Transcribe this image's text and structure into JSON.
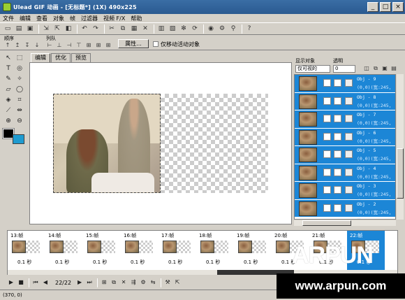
{
  "window": {
    "title": "Ulead GIF 动画 - [无标题*] (1X) 490x225",
    "controls": [
      "_",
      "□",
      "×"
    ]
  },
  "menu": [
    "文件",
    "编辑",
    "查看",
    "对象",
    "帧",
    "过滤器",
    "视频 F/X",
    "帮助"
  ],
  "attrbar": {
    "order_label": "顺序",
    "align_label": "列队",
    "properties_button": "属性...",
    "move_active_only_label": "仅移动活动对象"
  },
  "tabs": [
    "编辑",
    "优化",
    "预览"
  ],
  "right_panel": {
    "show_objects_label": "显示对象",
    "transparency_label": "透明",
    "show_mode_value": "仅可视的",
    "transparency_value": "0",
    "objects": [
      {
        "name": "Obj - 9",
        "pos": "(0,0)(宽:245,高"
      },
      {
        "name": "Obj - 8",
        "pos": "(0,0)(宽:245,高"
      },
      {
        "name": "Obj - 7",
        "pos": "(0,0)(宽:245,高"
      },
      {
        "name": "Obj - 6",
        "pos": "(0,0)(宽:245,高"
      },
      {
        "name": "Obj - 5",
        "pos": "(0,0)(宽:245,高"
      },
      {
        "name": "Obj - 4",
        "pos": "(0,0)(宽:245,高"
      },
      {
        "name": "Obj - 3",
        "pos": "(0,0)(宽:245,高"
      },
      {
        "name": "Obj - 2",
        "pos": "(0,0)(宽:245,高"
      }
    ]
  },
  "frames": [
    {
      "label": "13:帧",
      "delay": "0.1 秒",
      "selected": false
    },
    {
      "label": "14:帧",
      "delay": "0.1 秒",
      "selected": false
    },
    {
      "label": "15:帧",
      "delay": "0.1 秒",
      "selected": false
    },
    {
      "label": "16:帧",
      "delay": "0.1 秒",
      "selected": false
    },
    {
      "label": "17:帧",
      "delay": "0.1 秒",
      "selected": false
    },
    {
      "label": "18:帧",
      "delay": "0.1 秒",
      "selected": false
    },
    {
      "label": "19:帧",
      "delay": "0.1 秒",
      "selected": false
    },
    {
      "label": "20:帧",
      "delay": "0.1 秒",
      "selected": false
    },
    {
      "label": "21:帧",
      "delay": "0.1 秒",
      "selected": false
    },
    {
      "label": "22:帧",
      "delay": "0.1 秒",
      "selected": true
    }
  ],
  "playback": {
    "frame_counter": "22/22"
  },
  "status": {
    "coords": "(370, 0)"
  },
  "watermark": {
    "logo": "ARPUN",
    "url": "www.arpun.com"
  },
  "colors": {
    "title_bar": "#2a5a90",
    "selection_blue": "#1c86d6",
    "background_color_swatch": "#1e9bd0",
    "foreground_color_swatch": "#000000"
  },
  "icons": {
    "toolbar": [
      "new-file-icon",
      "open-folder-icon",
      "save-icon",
      "import-icon",
      "export-icon",
      "color-icon",
      "undo-icon",
      "redo-icon",
      "cut-icon",
      "copy-icon",
      "paste-icon",
      "delete-icon",
      "frame-icon",
      "add-frame-icon",
      "tween-icon",
      "refresh-icon",
      "globe-icon",
      "tool-icon",
      "help-icon"
    ],
    "left_tools": [
      "pointer-tool-icon",
      "marquee-tool-icon",
      "text-tool-icon",
      "lasso-tool-icon",
      "brush-tool-icon",
      "magic-wand-tool-icon",
      "eraser-tool-icon",
      "ellipse-tool-icon",
      "fill-tool-icon",
      "crop-tool-icon",
      "eyedropper-tool-icon",
      "move-tool-icon",
      "zoom-in-tool-icon",
      "zoom-out-tool-icon"
    ]
  }
}
